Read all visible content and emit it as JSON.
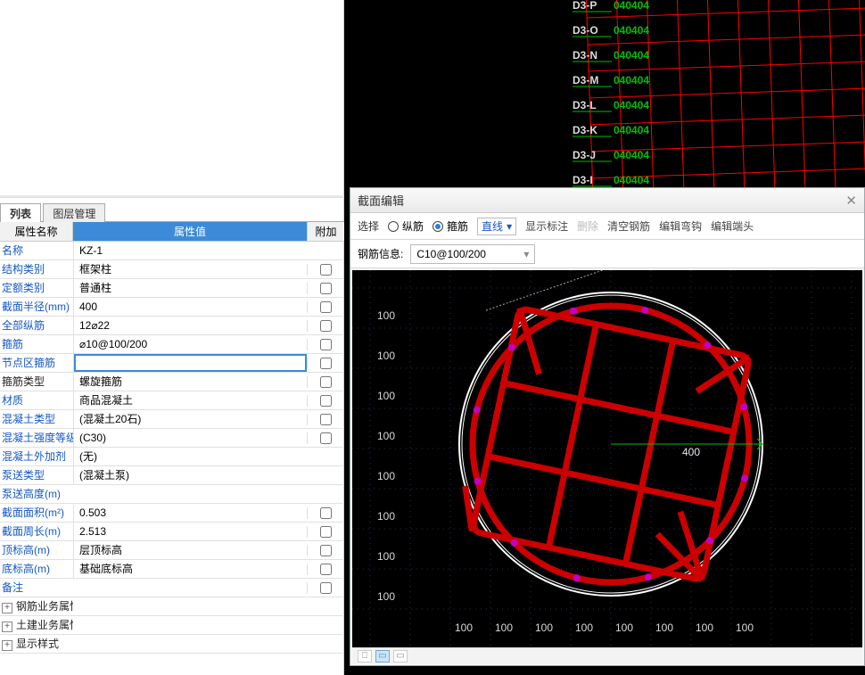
{
  "left": {
    "tabs": {
      "property_list": "列表",
      "layer_mgr": "图层管理"
    },
    "header": {
      "name": "属性名称",
      "value": "属性值",
      "extra": "附加"
    },
    "rows": [
      {
        "label": "名称",
        "value": "KZ-1",
        "blue": true,
        "chk": null
      },
      {
        "label": "结构类别",
        "value": "框架柱",
        "blue": true,
        "chk": false
      },
      {
        "label": "定额类别",
        "value": "普通柱",
        "blue": true,
        "chk": false
      },
      {
        "label": "截面半径(mm)",
        "value": "400",
        "blue": true,
        "chk": false
      },
      {
        "label": "全部纵筋",
        "value": "12⌀22",
        "blue": true,
        "chk": false
      },
      {
        "label": "箍筋",
        "value": "⌀10@100/200",
        "blue": true,
        "chk": false
      },
      {
        "label": "节点区箍筋",
        "value": "",
        "blue": true,
        "chk": false,
        "editing": true
      },
      {
        "label": "箍筋类型",
        "value": "螺旋箍筋",
        "blue": false,
        "chk": false
      },
      {
        "label": "材质",
        "value": "商品混凝土",
        "blue": true,
        "chk": false
      },
      {
        "label": "混凝土类型",
        "value": "(混凝土20石)",
        "blue": true,
        "chk": false
      },
      {
        "label": "混凝土强度等级",
        "value": "(C30)",
        "blue": true,
        "chk": false
      },
      {
        "label": "混凝土外加剂",
        "value": "(无)",
        "blue": true,
        "chk": null
      },
      {
        "label": "泵送类型",
        "value": "(混凝土泵)",
        "blue": true,
        "chk": null
      },
      {
        "label": "泵送高度(m)",
        "value": "",
        "blue": true,
        "chk": null
      },
      {
        "label": "截面面积(m²)",
        "value": "0.503",
        "blue": true,
        "chk": false
      },
      {
        "label": "截面周长(m)",
        "value": "2.513",
        "blue": true,
        "chk": false
      },
      {
        "label": "顶标高(m)",
        "value": "层顶标高",
        "blue": true,
        "chk": false
      },
      {
        "label": "底标高(m)",
        "value": "基础底标高",
        "blue": true,
        "chk": false
      },
      {
        "label": "备注",
        "value": "",
        "blue": true,
        "chk": false
      },
      {
        "label": "钢筋业务属性",
        "value": "",
        "blue": false,
        "chk": null,
        "group": true
      },
      {
        "label": "土建业务属性",
        "value": "",
        "blue": false,
        "chk": null,
        "group": true
      },
      {
        "label": "显示样式",
        "value": "",
        "blue": false,
        "chk": null,
        "group": true
      }
    ]
  },
  "viewport": {
    "grid_labels": [
      "D3-P",
      "D3-O",
      "D3-N",
      "D3-M",
      "D3-L",
      "D3-K",
      "D3-J",
      "D3-I"
    ]
  },
  "dialog": {
    "title": "截面编辑",
    "group_label": "选择",
    "radio_long": "纵筋",
    "radio_stirrup": "箍筋",
    "line_ddl": "直线",
    "show_dim": "显示标注",
    "delete": "删除",
    "clear_rebar": "清空钢筋",
    "edit_hook": "编辑弯钩",
    "edit_end": "编辑端头",
    "rebar_info_label": "钢筋信息:",
    "rebar_info_value": "C10@100/200",
    "radius_label": "400",
    "tick_labels": [
      "100",
      "100",
      "100",
      "100",
      "100",
      "100",
      "100",
      "100"
    ]
  }
}
